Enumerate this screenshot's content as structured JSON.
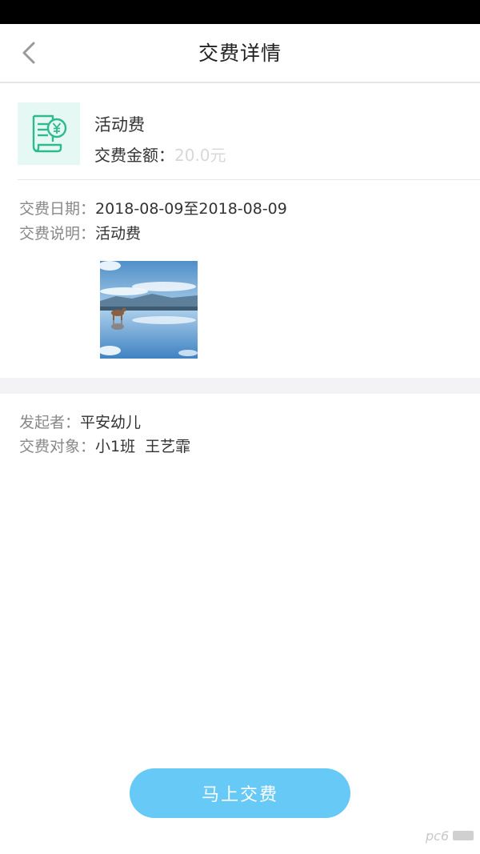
{
  "nav": {
    "title": "交费详情",
    "back_icon": "chevron-left-icon"
  },
  "fee": {
    "icon": "receipt-yen-icon",
    "name": "活动费",
    "amount_label": "交费金额：",
    "amount_value": "20.0元"
  },
  "details": {
    "date_label": "交费日期：",
    "date_value": "2018-08-09至2018-08-09",
    "desc_label": "交费说明：",
    "desc_value": "活动费"
  },
  "attachment": {
    "type": "photo",
    "subject": "salt-lake-reflection"
  },
  "meta": {
    "initiator_label": "发起者：",
    "initiator_value": "平安幼儿",
    "target_label": "交费对象：",
    "target_value": "小1班  王艺霏"
  },
  "action": {
    "pay_label": "马上交费"
  },
  "colors": {
    "accent": "#67c9f6",
    "icon_green": "#2dbb8c",
    "icon_bg": "#e6f8f3",
    "muted_amount": "#d8d8d8"
  }
}
